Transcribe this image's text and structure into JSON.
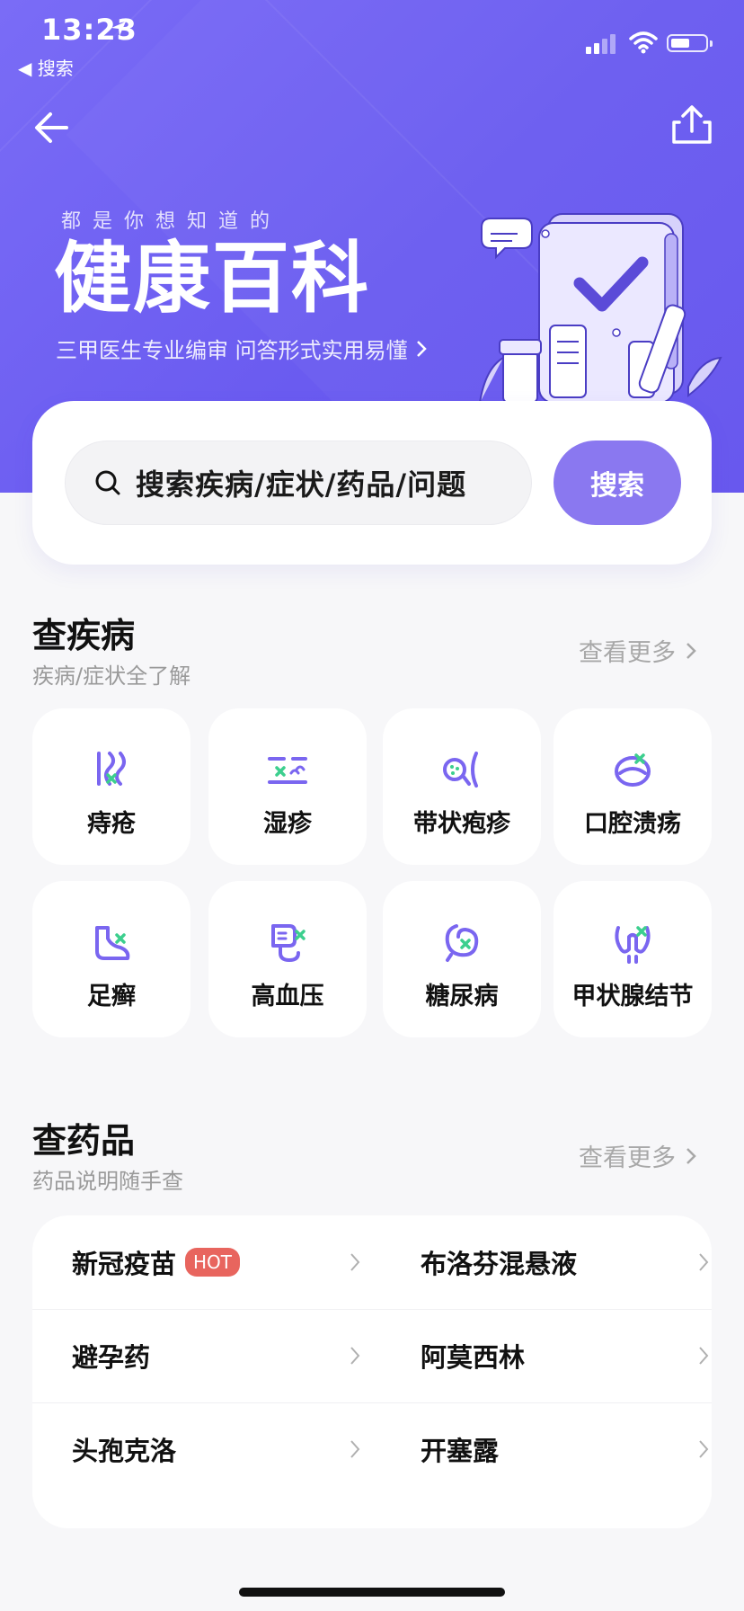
{
  "status_bar": {
    "time": "13:23",
    "back_app": "◀ 搜索"
  },
  "hero": {
    "tagline": "都是你想知道的",
    "title": "健康百科",
    "subline": "三甲医生专业编审  问答形式实用易懂"
  },
  "search": {
    "placeholder": "搜索疾病/症状/药品/问题",
    "button": "搜索"
  },
  "diseases": {
    "title": "查疾病",
    "subtitle": "疾病/症状全了解",
    "more": "查看更多",
    "items": [
      {
        "label": "痔疮",
        "icon": "hemorrhoid-icon"
      },
      {
        "label": "湿疹",
        "icon": "eczema-icon"
      },
      {
        "label": "带状疱疹",
        "icon": "shingles-icon"
      },
      {
        "label": "口腔溃疡",
        "icon": "mouth-ulcer-icon"
      },
      {
        "label": "足癣",
        "icon": "foot-icon"
      },
      {
        "label": "高血压",
        "icon": "blood-pressure-icon"
      },
      {
        "label": "糖尿病",
        "icon": "diabetes-icon"
      },
      {
        "label": "甲状腺结节",
        "icon": "thyroid-icon"
      }
    ]
  },
  "drugs": {
    "title": "查药品",
    "subtitle": "药品说明随手查",
    "more": "查看更多",
    "items": [
      {
        "name": "新冠疫苗",
        "badge": "HOT"
      },
      {
        "name": "布洛芬混悬液"
      },
      {
        "name": "避孕药"
      },
      {
        "name": "阿莫西林"
      },
      {
        "name": "头孢克洛"
      },
      {
        "name": "开塞露"
      }
    ]
  },
  "colors": {
    "primary": "#6a5bf0",
    "button": "#8a78f0",
    "accent_green": "#3ccf8e",
    "hot": "#e8655e"
  }
}
